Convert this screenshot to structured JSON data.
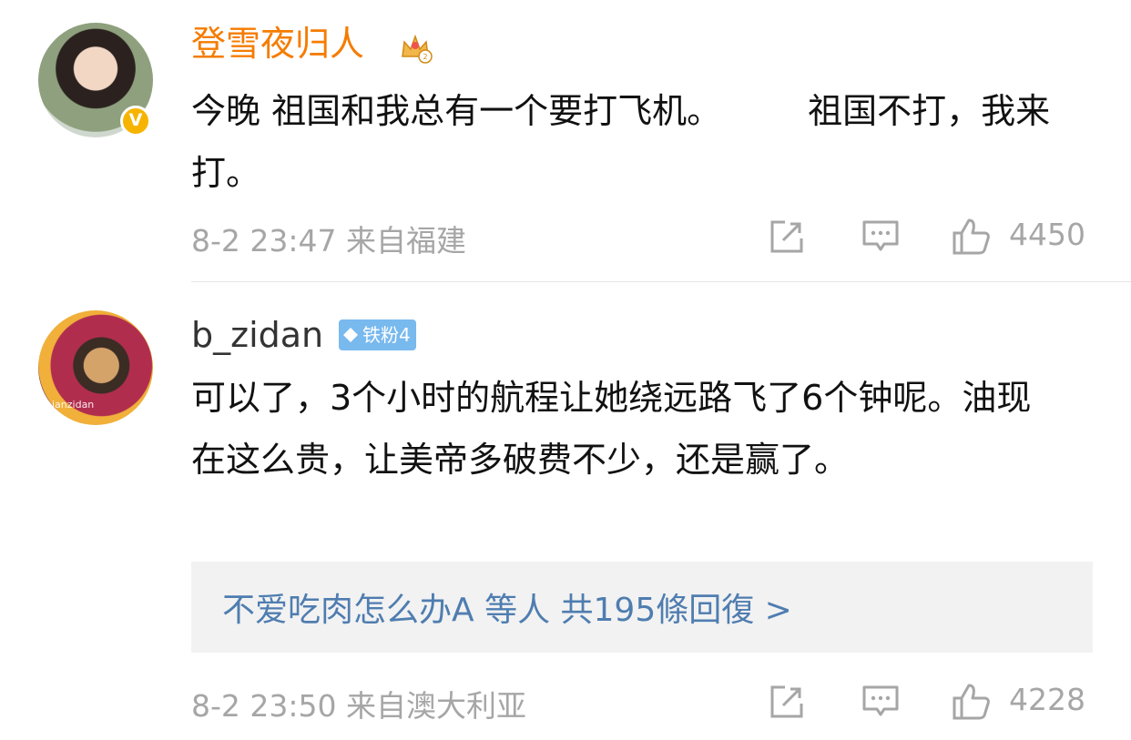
{
  "comments": [
    {
      "username": "登雪夜归人",
      "text": "今晚 祖国和我总有一个要打飞机。　　　祖国不打，我来打。",
      "meta": "8-2 23:47 来自福建",
      "likes": "4450",
      "verified_badge": "V",
      "crown_icon": "crown-icon"
    },
    {
      "username": "b_zidan",
      "fan_badge": "铁粉4",
      "avatar_watermark": "bianzidan",
      "text": "可以了，3个小时的航程让她绕远路飞了6个钟呢。油现在这么贵，让美帝多破费不少，还是赢了。",
      "reply_summary": "不爱吃肉怎么办A 等人 共195條回復 >",
      "meta": "8-2 23:50 来自澳大利亚",
      "likes": "4228"
    }
  ],
  "colors": {
    "username_vip": "#f57c00",
    "link": "#4f7db0",
    "meta": "#a6a6a6",
    "fan_badge": "#78b9ee"
  }
}
